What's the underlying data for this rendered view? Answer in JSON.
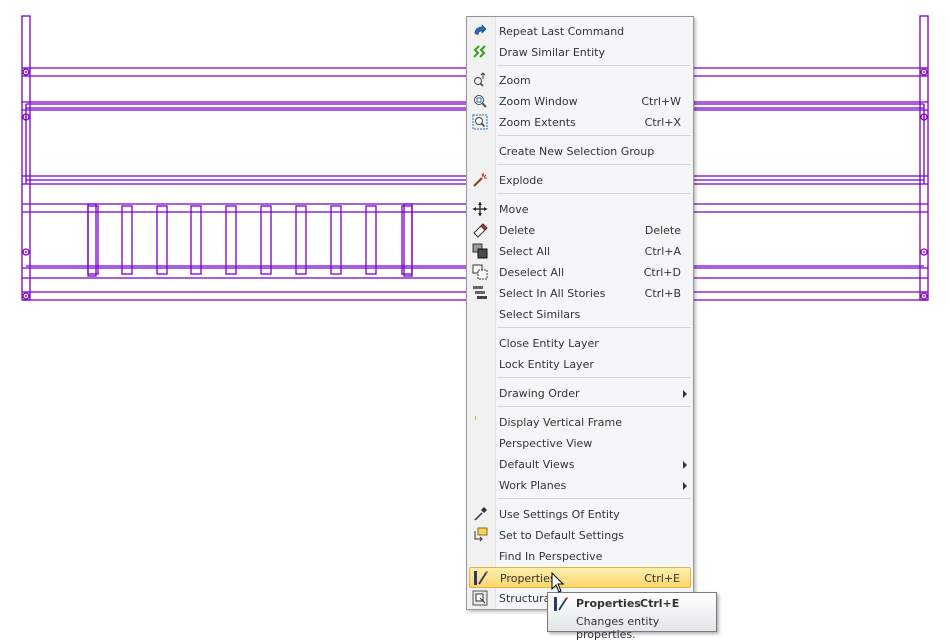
{
  "menu": {
    "items": [
      {
        "label": "Repeat Last Command",
        "shortcut": "",
        "icon": "repeat-icon",
        "submenu": false
      },
      {
        "label": "Draw Similar Entity",
        "shortcut": "",
        "icon": "draw-similar-icon",
        "submenu": false
      },
      {
        "label": "Zoom",
        "shortcut": "",
        "icon": "zoom-icon",
        "submenu": false
      },
      {
        "label": "Zoom Window",
        "shortcut": "Ctrl+W",
        "icon": "zoom-window-icon",
        "submenu": false
      },
      {
        "label": "Zoom Extents",
        "shortcut": "Ctrl+X",
        "icon": "zoom-extents-icon",
        "submenu": false
      },
      {
        "label": "Create New Selection Group",
        "shortcut": "",
        "icon": "",
        "submenu": false
      },
      {
        "label": "Explode",
        "shortcut": "",
        "icon": "explode-icon",
        "submenu": false
      },
      {
        "label": "Move",
        "shortcut": "",
        "icon": "move-icon",
        "submenu": false
      },
      {
        "label": "Delete",
        "shortcut": "Delete",
        "icon": "eraser-icon",
        "submenu": false
      },
      {
        "label": "Select All",
        "shortcut": "Ctrl+A",
        "icon": "select-all-icon",
        "submenu": false
      },
      {
        "label": "Deselect All",
        "shortcut": "Ctrl+D",
        "icon": "deselect-all-icon",
        "submenu": false
      },
      {
        "label": "Select In All Stories",
        "shortcut": "Ctrl+B",
        "icon": "select-stories-icon",
        "submenu": false
      },
      {
        "label": "Select Similars",
        "shortcut": "",
        "icon": "",
        "submenu": false
      },
      {
        "label": "Close Entity Layer",
        "shortcut": "",
        "icon": "",
        "submenu": false
      },
      {
        "label": "Lock Entity Layer",
        "shortcut": "",
        "icon": "",
        "submenu": false
      },
      {
        "label": "Drawing Order",
        "shortcut": "",
        "icon": "",
        "submenu": true
      },
      {
        "label": "Display Vertical Frame",
        "shortcut": "",
        "icon": "frame-marker-icon",
        "submenu": false
      },
      {
        "label": "Perspective View",
        "shortcut": "",
        "icon": "",
        "submenu": false
      },
      {
        "label": "Default Views",
        "shortcut": "",
        "icon": "",
        "submenu": true
      },
      {
        "label": "Work Planes",
        "shortcut": "",
        "icon": "",
        "submenu": true
      },
      {
        "label": "Use Settings Of Entity",
        "shortcut": "",
        "icon": "dropper-icon",
        "submenu": false
      },
      {
        "label": "Set to Default Settings",
        "shortcut": "",
        "icon": "default-settings-icon",
        "submenu": false
      },
      {
        "label": "Find In Perspective",
        "shortcut": "",
        "icon": "",
        "submenu": false
      },
      {
        "label": "Properties",
        "shortcut": "Ctrl+E",
        "icon": "properties-icon",
        "submenu": false,
        "highlighted": true
      },
      {
        "label": "Structural",
        "shortcut": "",
        "icon": "structural-icon",
        "submenu": false
      }
    ]
  },
  "tooltip": {
    "title": "Properties",
    "shortcut": "Ctrl+E",
    "description": "Changes entity properties."
  },
  "colors": {
    "drawing": "#7a00cc",
    "node": "#e0002a",
    "highlight": "#fbd66b"
  }
}
